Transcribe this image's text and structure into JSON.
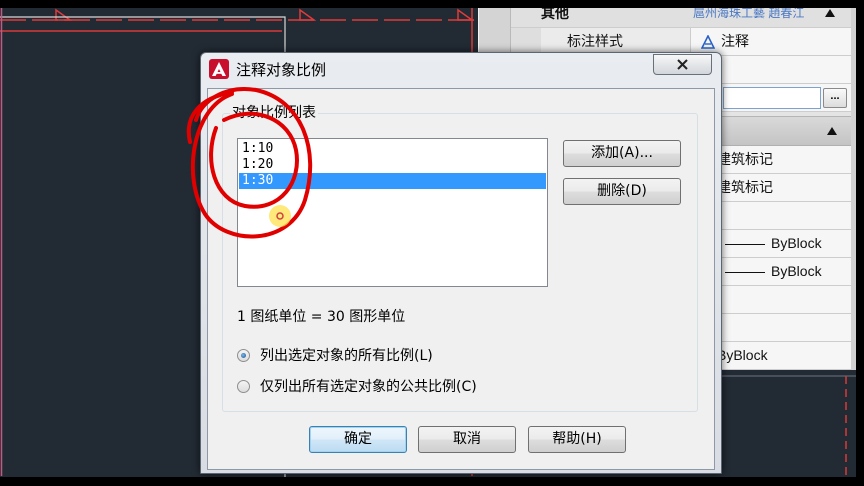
{
  "properties_panel": {
    "category_other": "其他",
    "watermark": "扈州海珠工藝 趙春江",
    "dim_style_label": "标注样式",
    "dim_style_value": "注释",
    "ellipsis": "...",
    "value_rows": [
      {
        "value": "建筑标记",
        "line": false
      },
      {
        "value": "建筑标记",
        "line": false
      },
      {
        "value": "",
        "line": false
      },
      {
        "value": "ByBlock",
        "line": true
      },
      {
        "value": "ByBlock",
        "line": true
      },
      {
        "value": "",
        "line": false
      },
      {
        "value": "",
        "line": false
      },
      {
        "value": "ByBlock",
        "line": false
      }
    ],
    "icons": {
      "collapse": "collapse-up-icon",
      "annotative": "annotative-icon"
    }
  },
  "dialog": {
    "title": "注释对象比例",
    "icon": "autocad-logo-icon",
    "close_icon": "close-icon",
    "group_label": "对象比例列表",
    "scales": [
      {
        "label": "1:10",
        "selected": false
      },
      {
        "label": "1:20",
        "selected": false
      },
      {
        "label": "1:30",
        "selected": true
      }
    ],
    "add_button": "添加(A)...",
    "delete_button": "删除(D)",
    "ratio_text": "1 图纸单位 = 30 图形单位",
    "radio_options": [
      {
        "label": "列出选定对象的所有比例(L)",
        "checked": true
      },
      {
        "label": "仅列出所有选定对象的公共比例(C)",
        "checked": false
      }
    ],
    "ok_button": "确定",
    "cancel_button": "取消",
    "help_button": "帮助(H)"
  },
  "colors": {
    "drawing_background": "#222a33",
    "selection": "#3399ff",
    "annotation_red": "#e00000",
    "watermark_blue": "#4a78c4"
  }
}
